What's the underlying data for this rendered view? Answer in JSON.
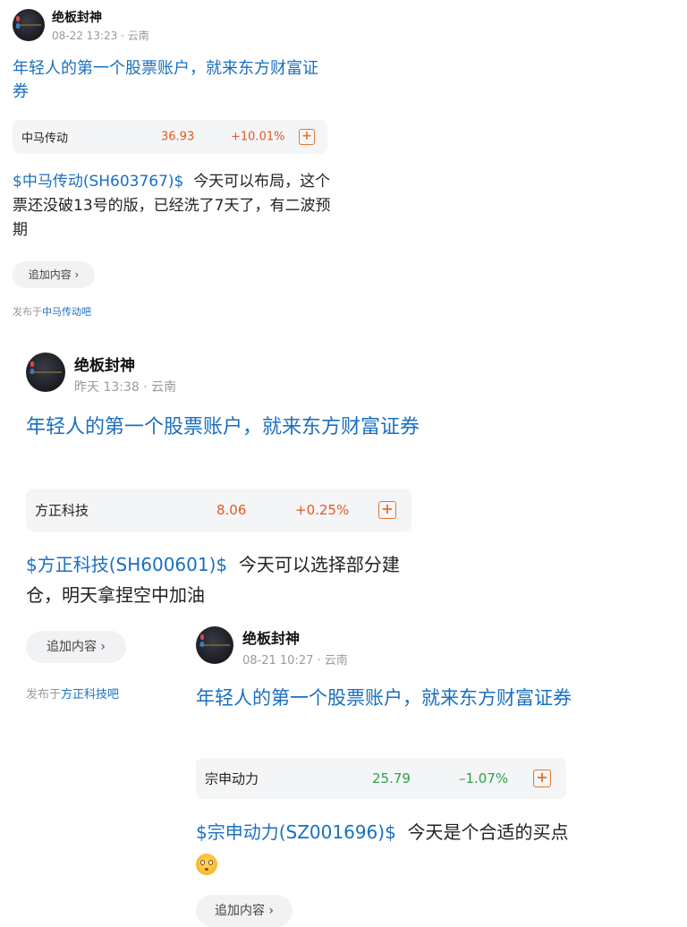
{
  "posts": [
    {
      "author": "绝板封神",
      "meta": "08-22 13:23 · 云南",
      "ad_title": "年轻人的第一个股票账户，就来东方财富证券",
      "stock": {
        "name": "中马传动",
        "price": "36.93",
        "change": "+10.01%",
        "direction": "up",
        "add_icon": "plus-square-icon"
      },
      "tag": "$中马传动(SH603767)$",
      "text": "今天可以布局，这个票还没破13号的版，已经洗了7天了，有二波预期",
      "add_content_label": "追加内容 ›",
      "posted_in_prefix": "发布于",
      "posted_in_bar": "中马传动吧"
    },
    {
      "author": "绝板封神",
      "meta": "昨天 13:38 · 云南",
      "ad_title": "年轻人的第一个股票账户，就来东方财富证券",
      "stock": {
        "name": "方正科技",
        "price": "8.06",
        "change": "+0.25%",
        "direction": "up",
        "add_icon": "plus-square-icon"
      },
      "tag": "$方正科技(SH600601)$",
      "text": "今天可以选择部分建仓，明天拿捏空中加油",
      "add_content_label": "追加内容 ›",
      "posted_in_prefix": "发布于",
      "posted_in_bar": "方正科技吧"
    },
    {
      "author": "绝板封神",
      "meta": "08-21 10:27 · 云南",
      "ad_title": "年轻人的第一个股票账户，就来东方财富证券",
      "stock": {
        "name": "宗申动力",
        "price": "25.79",
        "change": "–1.07%",
        "direction": "down",
        "add_icon": "plus-square-icon"
      },
      "tag": "$宗申动力(SZ001696)$",
      "text": "今天是个合适的买点",
      "emoji": "flushed-face-emoji",
      "add_content_label": "追加内容 ›"
    }
  ],
  "colors": {
    "link_blue": "#1a6fc2",
    "price_up": "#e35a1f",
    "price_down": "#2aa54a",
    "add_icon_orange": "#e3772e",
    "meta_gray": "#9a9a9a",
    "card_bg": "#f4f5f7"
  },
  "icons": {
    "plus_box": "+"
  }
}
